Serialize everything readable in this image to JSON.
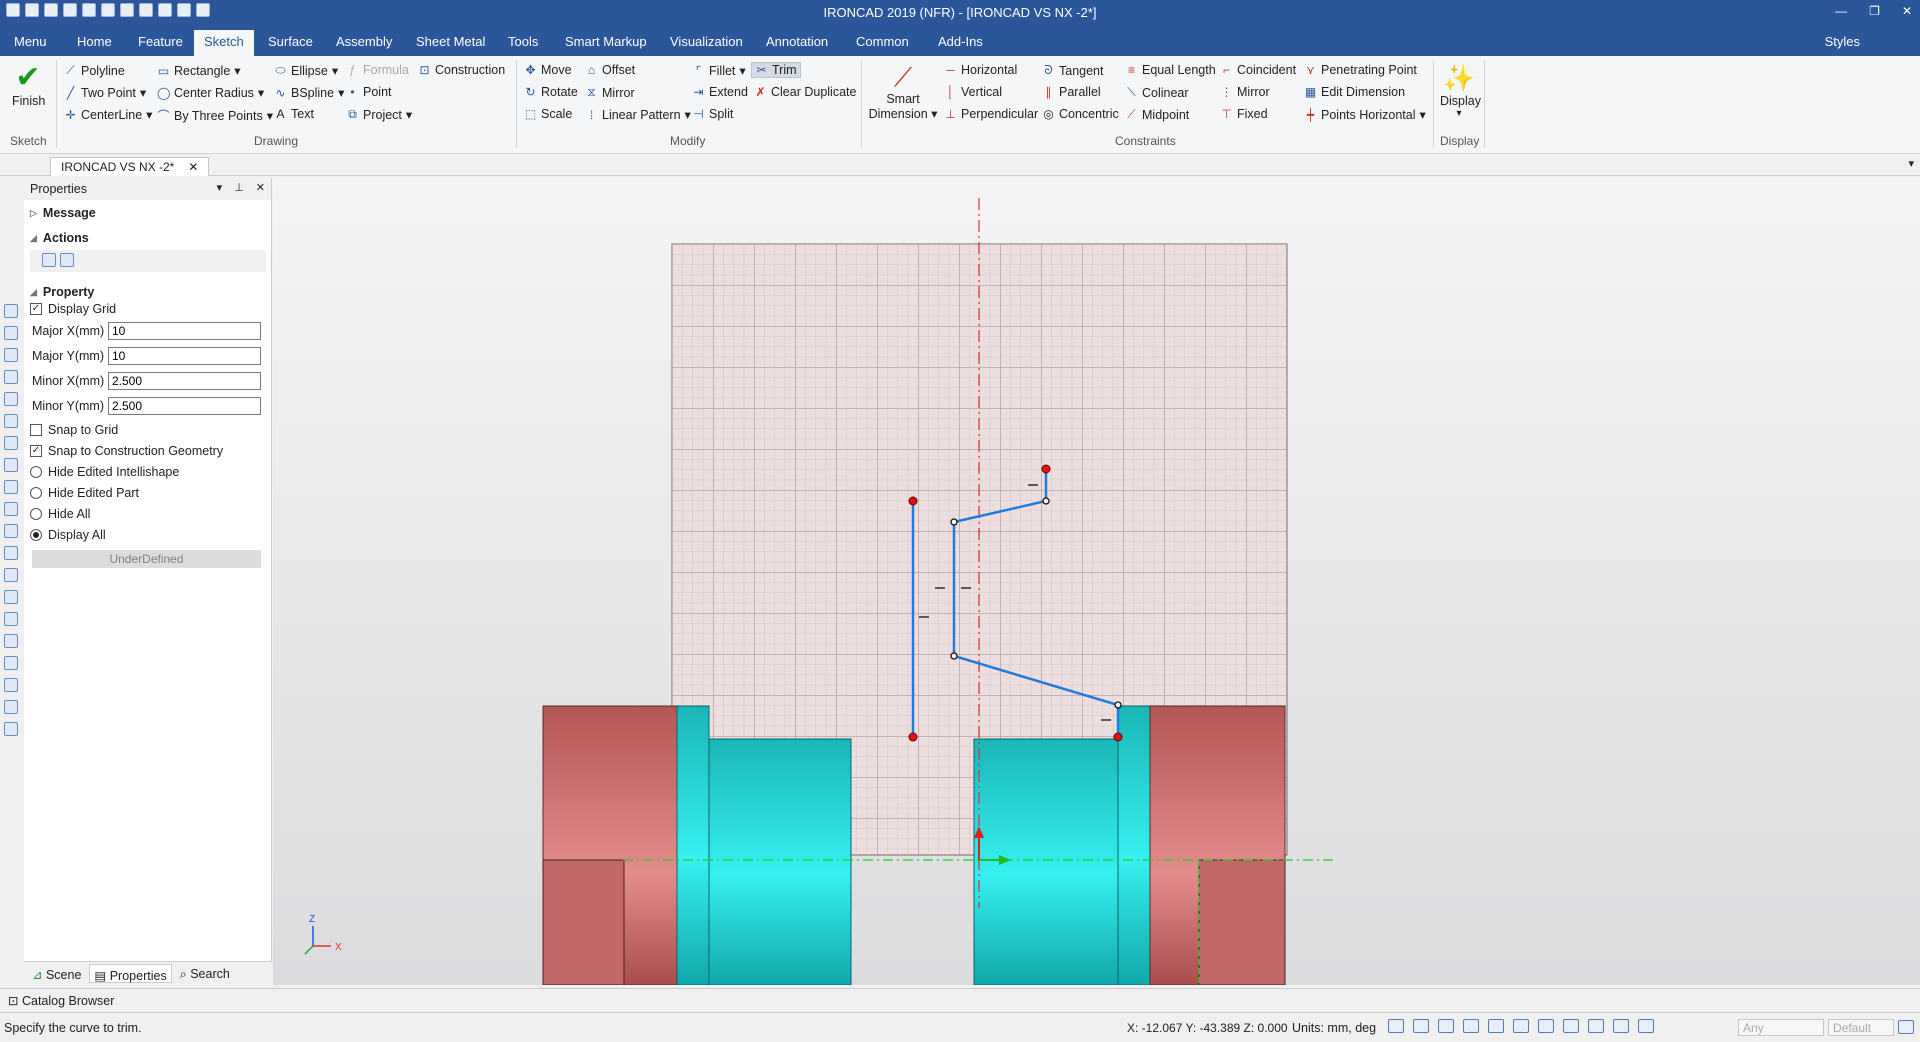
{
  "window": {
    "title": "IRONCAD 2019 (NFR) - [IRONCAD VS NX -2*]"
  },
  "menubar": {
    "tabs": [
      "Menu",
      "Home",
      "Feature",
      "Sketch",
      "Surface",
      "Assembly",
      "Sheet Metal",
      "Tools",
      "Smart Markup",
      "Visualization",
      "Annotation",
      "Common",
      "Add-Ins"
    ],
    "active": "Sketch",
    "styles": "Styles"
  },
  "ribbon": {
    "finish": "Finish",
    "smart_dimension_l1": "Smart",
    "smart_dimension_l2": "Dimension",
    "display_btn": "Display",
    "drawing": {
      "polyline": "Polyline",
      "two_point": "Two Point",
      "centerline": "CenterLine",
      "rectangle": "Rectangle",
      "center_radius": "Center Radius",
      "by_three_points": "By Three Points",
      "ellipse": "Ellipse",
      "bspline": "BSpline",
      "text": "Text",
      "formula": "Formula",
      "point": "Point",
      "project": "Project",
      "construction": "Construction"
    },
    "modify": {
      "move": "Move",
      "rotate": "Rotate",
      "scale": "Scale",
      "offset": "Offset",
      "mirror": "Mirror",
      "linear_pattern": "Linear Pattern",
      "fillet": "Fillet",
      "extend": "Extend",
      "split": "Split",
      "trim": "Trim",
      "clear_duplicate": "Clear Duplicate"
    },
    "constraints": {
      "horizontal": "Horizontal",
      "vertical": "Vertical",
      "perpendicular": "Perpendicular",
      "tangent": "Tangent",
      "parallel": "Parallel",
      "concentric": "Concentric",
      "equal_length": "Equal Length",
      "colinear": "Colinear",
      "midpoint": "Midpoint",
      "coincident": "Coincident",
      "mirror": "Mirror",
      "fixed": "Fixed",
      "penetrating_point": "Penetrating Point",
      "edit_dimension": "Edit Dimension",
      "points_horizontal": "Points Horizontal"
    },
    "groups": {
      "sketch": "Sketch",
      "drawing": "Drawing",
      "modify": "Modify",
      "constraints": "Constraints",
      "display": "Display"
    }
  },
  "document_tab": {
    "label": "IRONCAD VS NX -2*"
  },
  "properties": {
    "title": "Properties",
    "message": "Message",
    "actions": "Actions",
    "property": "Property",
    "display_grid": "Display Grid",
    "fields": [
      {
        "label": "Major X(mm)",
        "value": "10"
      },
      {
        "label": "Major Y(mm)",
        "value": "10"
      },
      {
        "label": "Minor X(mm)",
        "value": "2.500"
      },
      {
        "label": "Minor Y(mm)",
        "value": "2.500"
      }
    ],
    "snap_to_grid": "Snap to Grid",
    "snap_to_construction": "Snap to Construction Geometry",
    "hide_edited_intellishape": "Hide Edited Intellishape",
    "hide_edited_part": "Hide Edited Part",
    "hide_all": "Hide All",
    "display_all": "Display All",
    "underdefined": "UnderDefined",
    "tabs": {
      "scene": "Scene",
      "properties": "Properties",
      "search": "Search"
    }
  },
  "catalog_browser": "Catalog Browser",
  "axis_triad": {
    "z": "Z",
    "x": "X"
  },
  "status": {
    "message": "Specify the curve to trim.",
    "coords": "X: -12.067 Y: -43.389 Z: 0.000",
    "units": "Units: mm, deg",
    "filter_any": "Any",
    "filter_default": "Default"
  },
  "colors": {
    "title_blue": "#2b579a",
    "sketch_line": "#1e7be0",
    "part_red": "#b55a5a",
    "part_cyan": "#1fc8c8",
    "grid_bg": "#ecdede"
  }
}
